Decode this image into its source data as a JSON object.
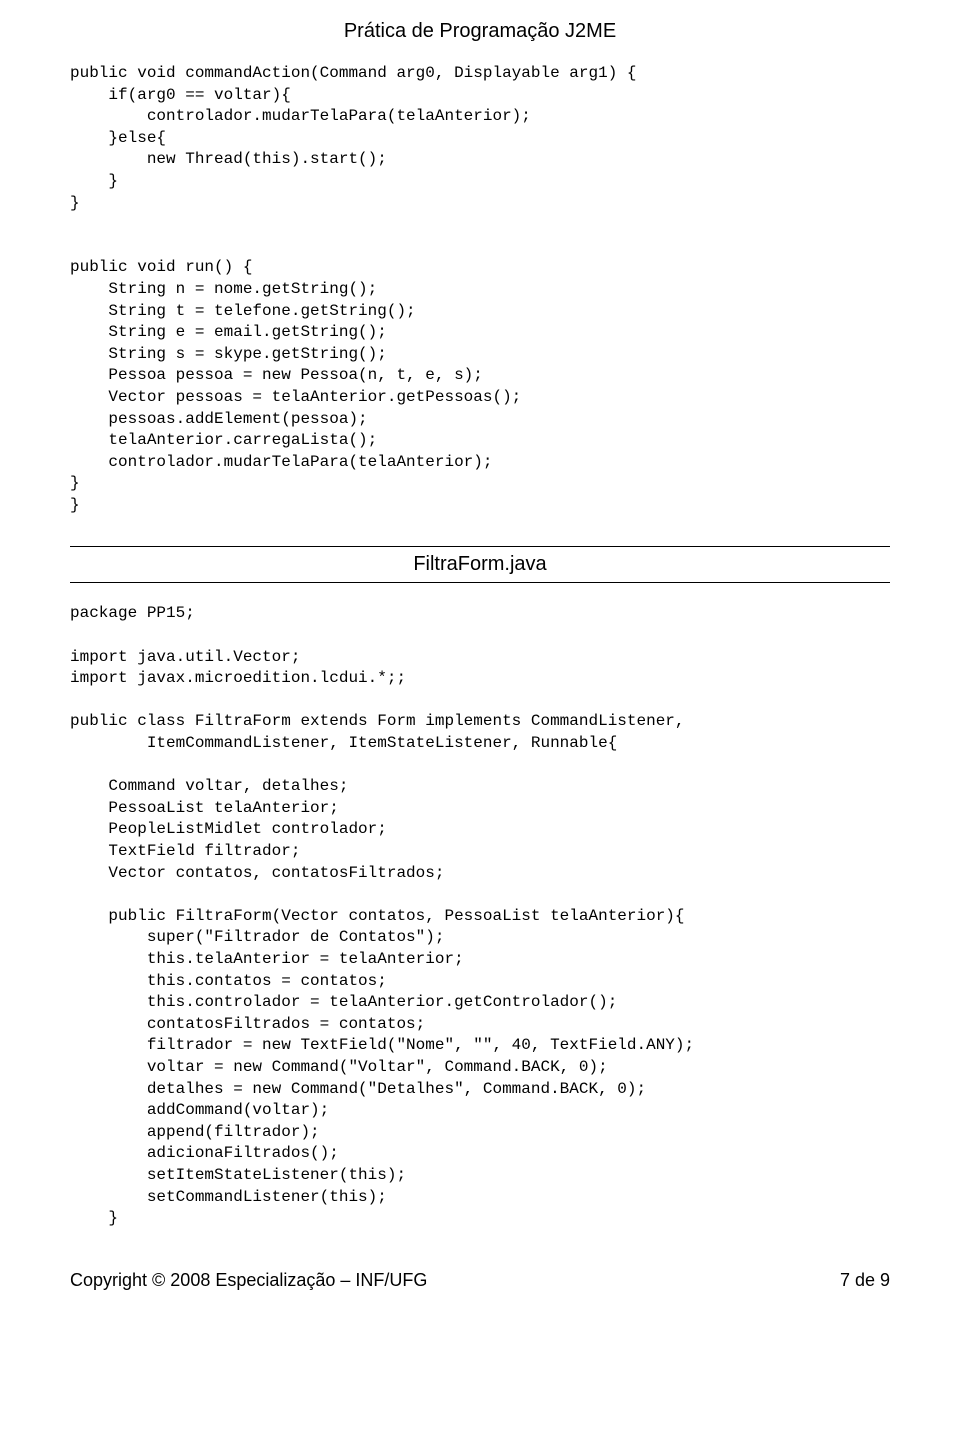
{
  "header": {
    "title": "Prática de Programação J2ME"
  },
  "code": {
    "block1": "public void commandAction(Command arg0, Displayable arg1) {\n    if(arg0 == voltar){\n        controlador.mudarTelaPara(telaAnterior);\n    }else{\n        new Thread(this).start();\n    }\n}\n\n\npublic void run() {\n    String n = nome.getString();\n    String t = telefone.getString();\n    String e = email.getString();\n    String s = skype.getString();\n    Pessoa pessoa = new Pessoa(n, t, e, s);\n    Vector pessoas = telaAnterior.getPessoas();\n    pessoas.addElement(pessoa);\n    telaAnterior.carregaLista();\n    controlador.mudarTelaPara(telaAnterior);\n}\n}",
    "block2": "package PP15;\n\nimport java.util.Vector;\nimport javax.microedition.lcdui.*;;\n\npublic class FiltraForm extends Form implements CommandListener,\n        ItemCommandListener, ItemStateListener, Runnable{\n\n    Command voltar, detalhes;\n    PessoaList telaAnterior;\n    PeopleListMidlet controlador;\n    TextField filtrador;\n    Vector contatos, contatosFiltrados;\n\n    public FiltraForm(Vector contatos, PessoaList telaAnterior){\n        super(\"Filtrador de Contatos\");\n        this.telaAnterior = telaAnterior;\n        this.contatos = contatos;\n        this.controlador = telaAnterior.getControlador();\n        contatosFiltrados = contatos;\n        filtrador = new TextField(\"Nome\", \"\", 40, TextField.ANY);\n        voltar = new Command(\"Voltar\", Command.BACK, 0);\n        detalhes = new Command(\"Detalhes\", Command.BACK, 0);\n        addCommand(voltar);\n        append(filtrador);\n        adicionaFiltrados();\n        setItemStateListener(this);\n        setCommandListener(this);\n    }"
  },
  "section": {
    "title": "FiltraForm.java"
  },
  "footer": {
    "left": "Copyright © 2008 Especialização – INF/UFG",
    "right": "7 de 9"
  }
}
